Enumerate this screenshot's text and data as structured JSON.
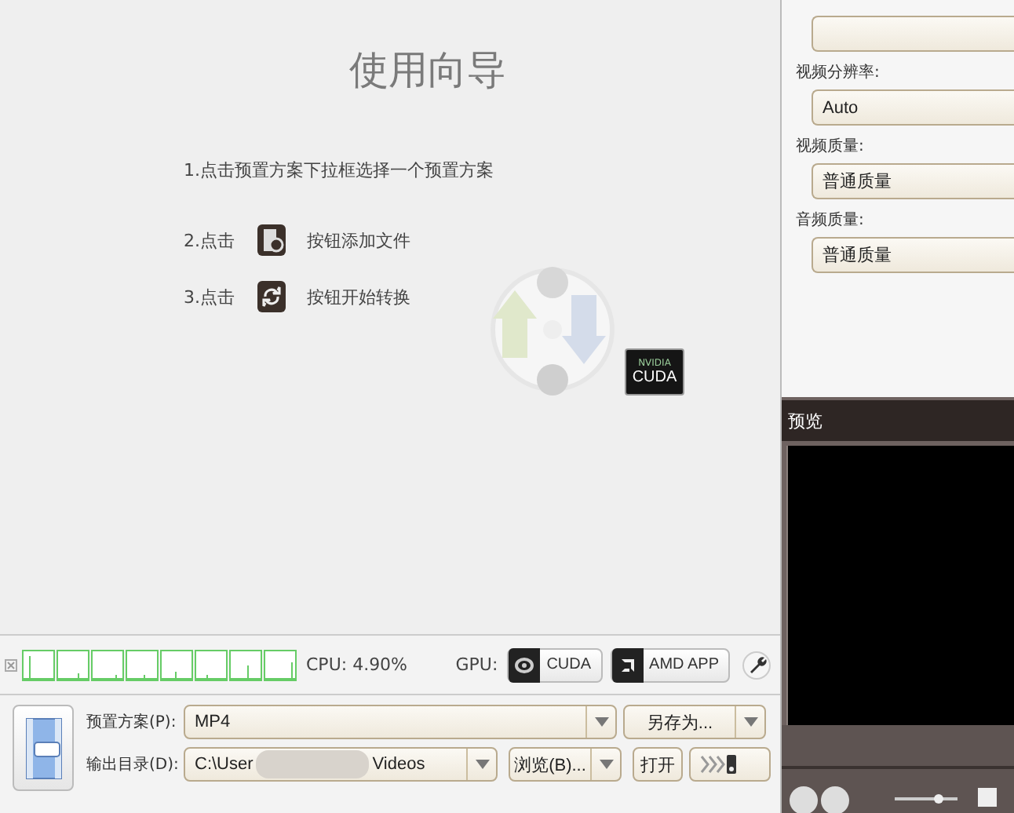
{
  "guide": {
    "title": "使用向导",
    "steps": [
      {
        "kind": "text",
        "text": "1.点击预置方案下拉框选择一个预置方案"
      },
      {
        "kind": "film",
        "prefix": "2.点击",
        "suffix": "按钮添加文件"
      },
      {
        "kind": "convert",
        "prefix": "3.点击",
        "suffix": "按钮开始转换"
      }
    ],
    "badge": {
      "brand": "NVIDIA",
      "text": "CUDA"
    }
  },
  "monitor": {
    "cpu": "CPU: 4.90%",
    "gpu_label": "GPU:",
    "gpu_buttons": [
      {
        "kind": "nvidia",
        "text": "CUDA"
      },
      {
        "kind": "amd",
        "text": "AMD APP"
      }
    ]
  },
  "preset": {
    "label": "预置方案(P):",
    "value": "MP4",
    "save_as": "另存为..."
  },
  "output": {
    "label": "输出目录(D):",
    "path_start": "C:\\User",
    "path_end": "Videos",
    "browse": "浏览(B)...",
    "open": "打开"
  },
  "settings": [
    {
      "label": "视频分辨率:",
      "value": "Auto"
    },
    {
      "label": "视频质量:",
      "value": "普通质量"
    },
    {
      "label": "音频质量:",
      "value": "普通质量"
    }
  ],
  "preview": {
    "title": "预览"
  }
}
